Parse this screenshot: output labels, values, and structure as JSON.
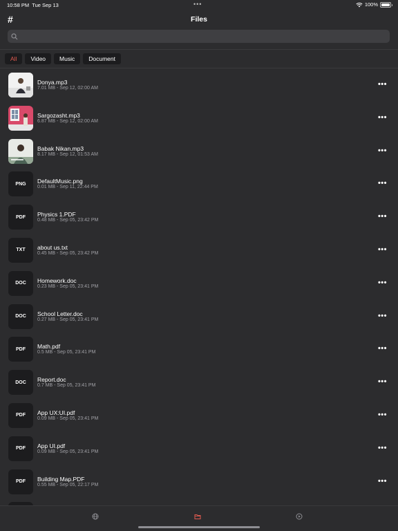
{
  "status_bar": {
    "time": "10:58 PM",
    "date": "Tue Sep 13",
    "battery": "100%"
  },
  "nav": {
    "title": "Files",
    "left_button": "#"
  },
  "search": {
    "placeholder": ""
  },
  "filters": [
    {
      "label": "All",
      "active": true
    },
    {
      "label": "Video",
      "active": false
    },
    {
      "label": "Music",
      "active": false
    },
    {
      "label": "Document",
      "active": false
    }
  ],
  "files": [
    {
      "name": "Donya.mp3",
      "meta": "7.01 MB - Sep 12, 02:00 AM",
      "type": "",
      "thumb": "photo-1"
    },
    {
      "name": "Sargozasht.mp3",
      "meta": "6.87 MB - Sep 12, 02:00 AM",
      "type": "",
      "thumb": "photo-2"
    },
    {
      "name": "Babak Nikan.mp3",
      "meta": "8.17 MB - Sep 12, 01:53 AM",
      "type": "",
      "thumb": "photo-3"
    },
    {
      "name": "DefaultMusic.png",
      "meta": "0.01 MB - Sep 11, 22:44 PM",
      "type": "PNG"
    },
    {
      "name": "Physics 1.PDF",
      "meta": "0.48 MB - Sep 05, 23:42 PM",
      "type": "PDF"
    },
    {
      "name": "about us.txt",
      "meta": "0.45 MB - Sep 05, 23:42 PM",
      "type": "TXT"
    },
    {
      "name": "Homework.doc",
      "meta": "0.23 MB - Sep 05, 23:41 PM",
      "type": "DOC"
    },
    {
      "name": "School Letter.doc",
      "meta": "0.27 MB - Sep 05, 23:41 PM",
      "type": "DOC"
    },
    {
      "name": "Math.pdf",
      "meta": "0.5 MB - Sep 05, 23:41 PM",
      "type": "PDF"
    },
    {
      "name": "Report.doc",
      "meta": "0.7 MB - Sep 05, 23:41 PM",
      "type": "DOC"
    },
    {
      "name": "App UX:UI.pdf",
      "meta": "0.09 MB - Sep 05, 23:41 PM",
      "type": "PDF"
    },
    {
      "name": "App UI.pdf",
      "meta": "0.09 MB - Sep 05, 23:41 PM",
      "type": "PDF"
    },
    {
      "name": "Building Map.PDF",
      "meta": "0.55 MB - Sep 05, 22:17 PM",
      "type": "PDF"
    }
  ],
  "more_glyph": "•••",
  "tabbar": {
    "tabs": [
      "globe-icon",
      "folder-icon",
      "play-circle-icon"
    ],
    "active": 1
  },
  "colors": {
    "accent": "#e05a4f",
    "background": "#2c2c2e",
    "chip": "#1c1c1e"
  }
}
